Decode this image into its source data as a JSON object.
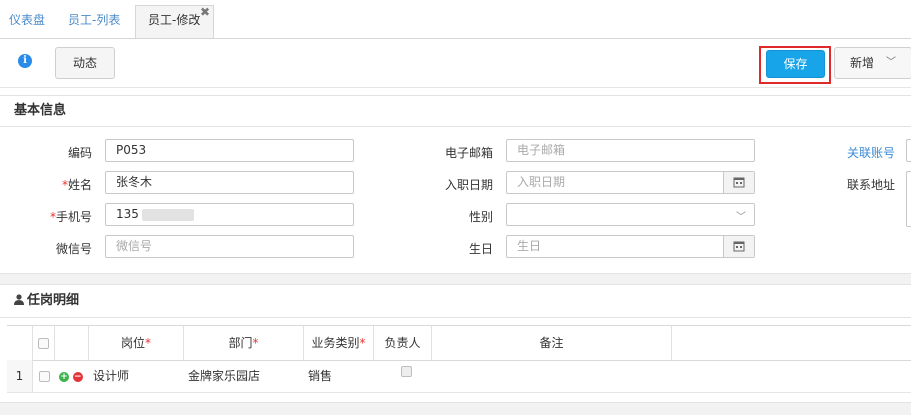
{
  "tabs": [
    {
      "label": "仪表盘"
    },
    {
      "label": "员工-列表"
    },
    {
      "label": "员工-修改"
    }
  ],
  "toolbar": {
    "dynamic_label": "动态",
    "save_label": "保存",
    "new_label": "新增"
  },
  "basic_info": {
    "title": "基本信息",
    "fields": {
      "code": {
        "label": "编码",
        "value": "P053"
      },
      "name": {
        "label": "姓名",
        "value": "张冬木"
      },
      "phone": {
        "label": "手机号",
        "value": "135"
      },
      "wechat": {
        "label": "微信号",
        "placeholder": "微信号"
      },
      "email": {
        "label": "电子邮箱",
        "placeholder": "电子邮箱"
      },
      "hire_date": {
        "label": "入职日期",
        "placeholder": "入职日期"
      },
      "gender": {
        "label": "性别",
        "value": ""
      },
      "birthday": {
        "label": "生日",
        "placeholder": "生日"
      },
      "linked_account": {
        "label": "关联账号"
      },
      "address": {
        "label": "联系地址"
      }
    }
  },
  "positions": {
    "title": "任岗明细",
    "columns": {
      "position": "岗位",
      "department": "部门",
      "business_type": "业务类别",
      "manager": "负责人",
      "remark": "备注"
    },
    "rows": [
      {
        "index": "1",
        "position": "设计师",
        "department": "金牌家乐园店",
        "business_type": "销售"
      }
    ]
  },
  "colors": {
    "accent": "#17a4e8",
    "highlight": "#e02a2a",
    "link": "#3d8bd6",
    "required": "#ee3333"
  }
}
